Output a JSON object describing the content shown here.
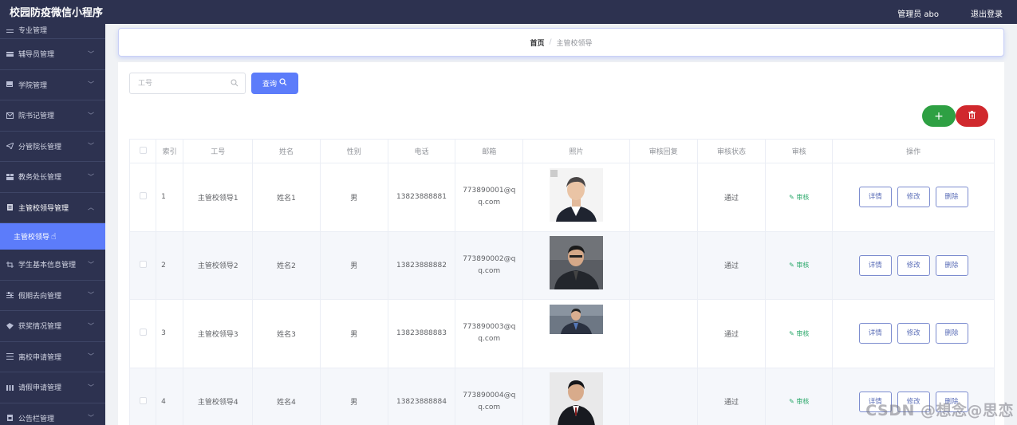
{
  "header": {
    "title": "校园防疫微信小程序",
    "admin": "管理员 abo",
    "logout": "退出登录"
  },
  "sidebar": {
    "partial_item": "专业管理",
    "items": [
      {
        "label": "辅导员管理",
        "icon": "stack-icon"
      },
      {
        "label": "学院管理",
        "icon": "book-icon"
      },
      {
        "label": "院书记管理",
        "icon": "envelope-icon"
      },
      {
        "label": "分管院长管理",
        "icon": "send-icon"
      },
      {
        "label": "教务处长管理",
        "icon": "grid-icon"
      }
    ],
    "open_item": {
      "label": "主管校领导管理",
      "icon": "document-icon"
    },
    "active_sub": "主管校领导",
    "items_after": [
      {
        "label": "学生基本信息管理",
        "icon": "crop-icon"
      },
      {
        "label": "假期去向管理",
        "icon": "sliders-icon"
      },
      {
        "label": "获奖情况管理",
        "icon": "medal-icon"
      },
      {
        "label": "离校申请管理",
        "icon": "list-icon"
      },
      {
        "label": "请假申请管理",
        "icon": "calendar-icon"
      },
      {
        "label": "公告栏管理",
        "icon": "board-icon"
      }
    ]
  },
  "breadcrumb": {
    "home": "首页",
    "separator": "/",
    "current": "主管校领导"
  },
  "search": {
    "placeholder": "工号",
    "query_button": "查询"
  },
  "actions": {
    "add_symbol": "+",
    "delete_icon": "trash-icon"
  },
  "table": {
    "headers": [
      "索引",
      "工号",
      "姓名",
      "性别",
      "电话",
      "邮箱",
      "照片",
      "审核回复",
      "审核状态",
      "审核",
      "操作"
    ],
    "rows": [
      {
        "index": "1",
        "job_no": "主管校领导1",
        "name": "姓名1",
        "gender": "男",
        "phone": "13823888881",
        "email_a": "773890001@q",
        "email_b": "q.com",
        "reply": "",
        "status": "通过",
        "audit": "审核",
        "photo": "portrait-photo"
      },
      {
        "index": "2",
        "job_no": "主管校领导2",
        "name": "姓名2",
        "gender": "男",
        "phone": "13823888882",
        "email_a": "773890002@q",
        "email_b": "q.com",
        "reply": "",
        "status": "通过",
        "audit": "审核",
        "photo": "portrait-photo"
      },
      {
        "index": "3",
        "job_no": "主管校领导3",
        "name": "姓名3",
        "gender": "男",
        "phone": "13823888883",
        "email_a": "773890003@q",
        "email_b": "q.com",
        "reply": "",
        "status": "通过",
        "audit": "审核",
        "photo": "portrait-photo"
      },
      {
        "index": "4",
        "job_no": "主管校领导4",
        "name": "姓名4",
        "gender": "男",
        "phone": "13823888884",
        "email_a": "773890004@q",
        "email_b": "q.com",
        "reply": "",
        "status": "通过",
        "audit": "审核",
        "photo": "portrait-photo"
      }
    ],
    "op_labels": {
      "detail": "详情",
      "edit": "修改",
      "delete": "删除"
    }
  },
  "watermark": "CSDN @想念@思恋",
  "colors": {
    "sidebar_bg": "#2d3250",
    "accent": "#5c7cfa",
    "add_green": "#2ea043",
    "delete_red": "#d0282d",
    "audit_green": "#2aa86a"
  }
}
